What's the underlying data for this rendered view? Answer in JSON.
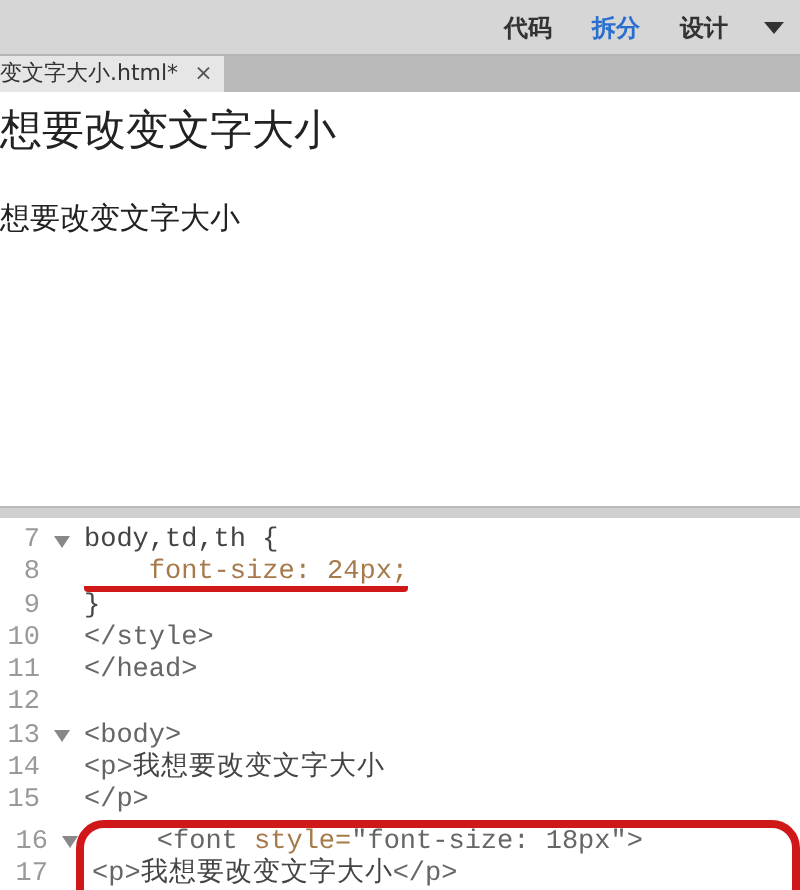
{
  "toolbar": {
    "view_tabs": [
      {
        "label": "代码",
        "selected": false
      },
      {
        "label": "拆分",
        "selected": true
      },
      {
        "label": "设计",
        "selected": false
      }
    ]
  },
  "document_tab": {
    "title": "变文字大小.html*",
    "close": "×"
  },
  "design_view": {
    "lines": [
      {
        "kind": "heading",
        "text": "想要改变文字大小"
      },
      {
        "kind": "paragraph",
        "text": "想要改变文字大小"
      }
    ]
  },
  "code_view": {
    "lines": [
      {
        "number": "7",
        "foldable": true,
        "underlined": false,
        "boxed": false,
        "tokens": [
          {
            "kind": "plain",
            "text": "body,td,th {"
          }
        ]
      },
      {
        "number": "8",
        "foldable": false,
        "underlined": true,
        "boxed": false,
        "tokens": [
          {
            "kind": "prop",
            "text": "    font-size: 24px;"
          }
        ]
      },
      {
        "number": "9",
        "foldable": false,
        "underlined": false,
        "boxed": false,
        "tokens": [
          {
            "kind": "plain",
            "text": "}"
          }
        ]
      },
      {
        "number": "10",
        "foldable": false,
        "underlined": false,
        "boxed": false,
        "tokens": [
          {
            "kind": "tag",
            "text": "</style>"
          }
        ]
      },
      {
        "number": "11",
        "foldable": false,
        "underlined": false,
        "boxed": false,
        "tokens": [
          {
            "kind": "tag",
            "text": "</head>"
          }
        ]
      },
      {
        "number": "12",
        "foldable": false,
        "underlined": false,
        "boxed": false
      },
      {
        "number": "13",
        "foldable": true,
        "underlined": false,
        "boxed": false,
        "tokens": [
          {
            "kind": "tag",
            "text": "<body>"
          }
        ]
      },
      {
        "number": "14",
        "foldable": false,
        "underlined": false,
        "boxed": false,
        "tokens": [
          {
            "kind": "tag",
            "text": "<p>"
          },
          {
            "kind": "plain",
            "text": "我想要改变文字大小"
          }
        ]
      },
      {
        "number": "15",
        "foldable": false,
        "underlined": false,
        "boxed": false,
        "tokens": [
          {
            "kind": "tag",
            "text": "</p>"
          }
        ]
      },
      {
        "number": "16",
        "foldable": true,
        "underlined": false,
        "boxed": true,
        "tokens": [
          {
            "kind": "tag",
            "text": "    <font "
          },
          {
            "kind": "prop",
            "text": "style="
          },
          {
            "kind": "tag",
            "text": "\"font-size: 18px\">"
          }
        ]
      },
      {
        "number": "17",
        "foldable": false,
        "underlined": false,
        "boxed": true,
        "tokens": [
          {
            "kind": "tag",
            "text": "<p>"
          },
          {
            "kind": "plain",
            "text": "我想要改变文字大小"
          },
          {
            "kind": "tag",
            "text": "</p>"
          }
        ]
      }
    ]
  }
}
